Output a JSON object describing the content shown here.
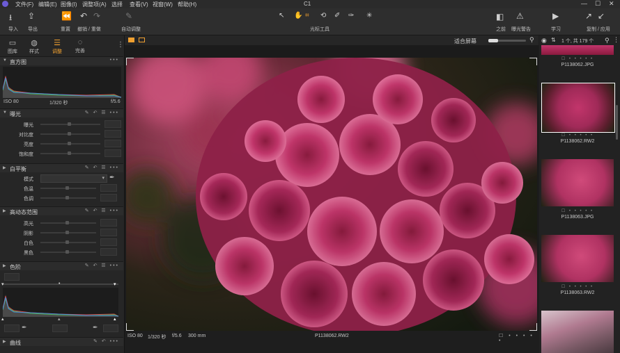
{
  "app": {
    "title": "C1"
  },
  "menu": [
    "文件(F)",
    "编辑(E)",
    "图像(I)",
    "调整项(A)",
    "选择",
    "查看(V)",
    "视窗(W)",
    "帮助(H)"
  ],
  "toolbar": {
    "import": "导入",
    "export": "导出",
    "reset": "重置",
    "undo_redo": "撤销 / 重做",
    "auto_adjust": "自动调整",
    "cursor_tools": "光标工具",
    "before": "之前",
    "exposure_warning": "曝光警告",
    "learn": "学习",
    "copy_apply": "复制 / 应用"
  },
  "left_tabs": [
    {
      "label": "图库",
      "icon": "folder-icon"
    },
    {
      "label": "样式",
      "icon": "style-icon"
    },
    {
      "label": "调整",
      "icon": "sliders-icon"
    },
    {
      "label": "完善",
      "icon": "refine-icon"
    }
  ],
  "histogram": {
    "title": "直方图",
    "iso": "ISO 80",
    "shutter": "1/320 秒",
    "aperture": "f/5.6"
  },
  "exposure": {
    "title": "曝光",
    "rows": [
      "曝光",
      "对比度",
      "亮度",
      "饱和度"
    ]
  },
  "white_balance": {
    "title": "白平衡",
    "rows": [
      "模式",
      "色温",
      "色调"
    ]
  },
  "hdr": {
    "title": "高动态范围",
    "rows": [
      "高光",
      "阴影",
      "白色",
      "黑色"
    ]
  },
  "levels": {
    "title": "色阶"
  },
  "curves": {
    "title": "曲线"
  },
  "viewer": {
    "fit_label": "适合屏幕",
    "filename": "P1138062.RW2",
    "iso": "ISO 80",
    "shutter": "1/320 秒",
    "aperture": "f/5.6",
    "focal": "300 mm"
  },
  "browser": {
    "count": "1 个, 共 179 个",
    "items": [
      "P1138062.JPG",
      "P1138062.RW2",
      "P1138063.JPG",
      "P1138063.RW2"
    ]
  },
  "colors": {
    "accent": "#f0a030",
    "photo_pink": "#c2356b"
  }
}
